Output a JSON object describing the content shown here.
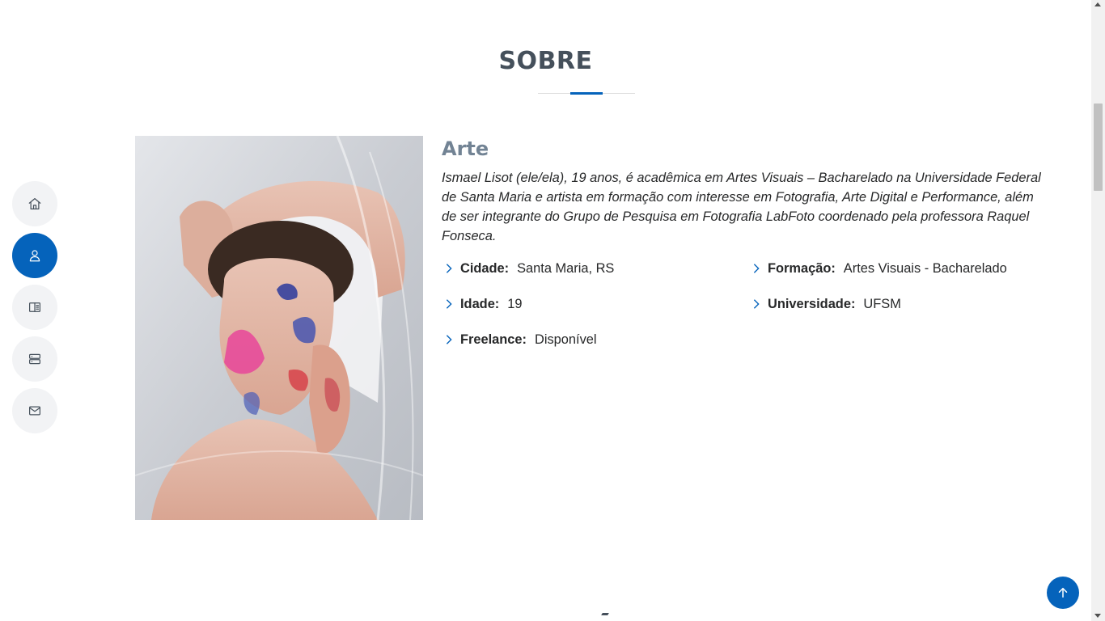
{
  "nav": {
    "items": [
      {
        "icon": "home-icon",
        "active": false
      },
      {
        "icon": "person-icon",
        "active": true
      },
      {
        "icon": "resume-icon",
        "active": false
      },
      {
        "icon": "server-icon",
        "active": false
      },
      {
        "icon": "envelope-icon",
        "active": false
      }
    ]
  },
  "section": {
    "title": "SOBRE"
  },
  "about": {
    "heading": "Arte",
    "intro": "Ismael Lisot (ele/ela), 19 anos, é acadêmica em Artes Visuais – Bacharelado na Universidade Federal de Santa Maria e artista em formação com interesse em Fotografia, Arte Digital e Performance, além de ser integrante do Grupo de Pesquisa em Fotografia LabFoto coordenado pela professora Raquel Fonseca.",
    "facts": [
      {
        "label": "Cidade:",
        "value": "Santa Maria, RS"
      },
      {
        "label": "Formação:",
        "value": "Artes Visuais - Bacharelado"
      },
      {
        "label": "Idade:",
        "value": "19"
      },
      {
        "label": "Universidade:",
        "value": "UFSM"
      },
      {
        "label": "Freelance:",
        "value": "Disponível"
      }
    ]
  },
  "colors": {
    "accent": "#0563bb",
    "heading": "#45505b",
    "subheading": "#728394"
  }
}
